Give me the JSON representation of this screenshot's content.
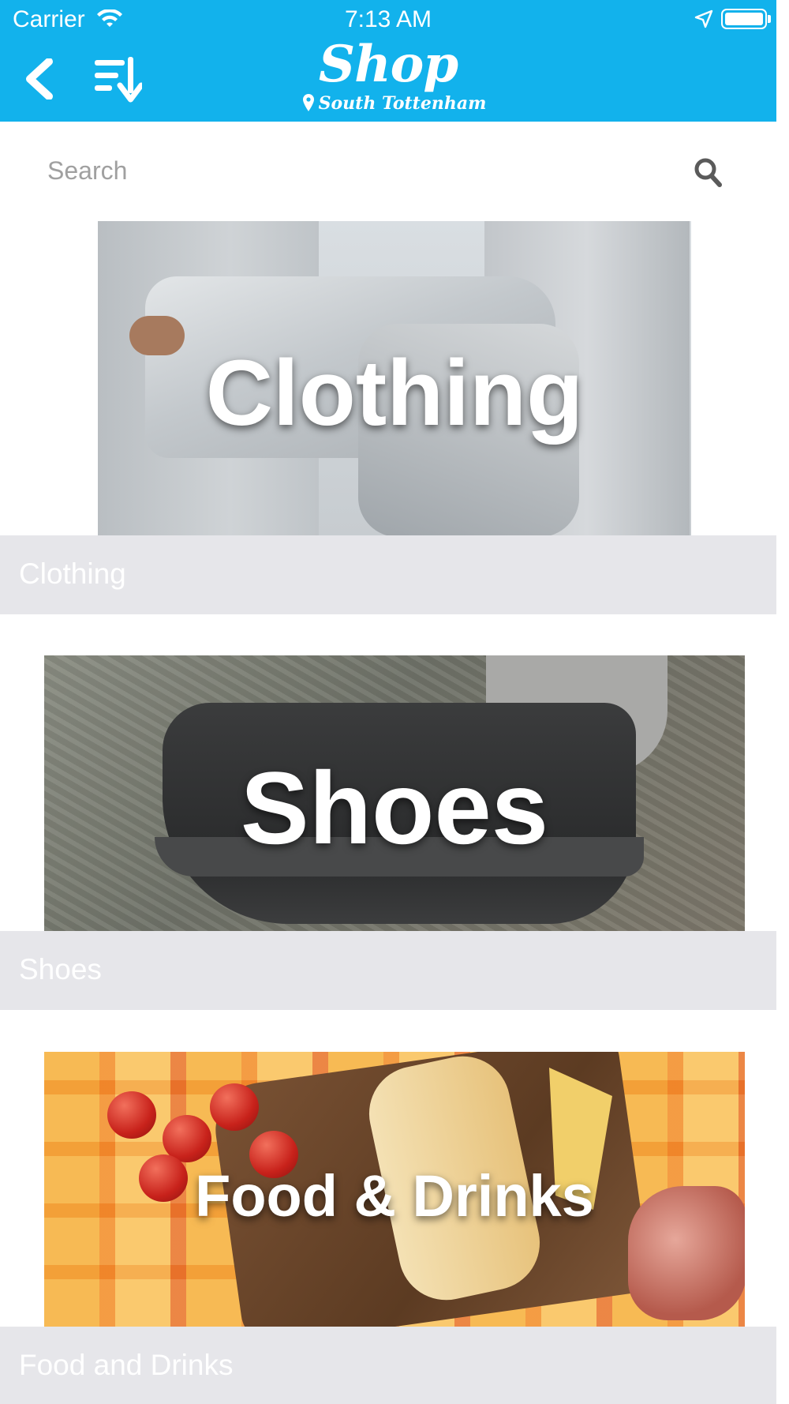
{
  "status_bar": {
    "carrier": "Carrier",
    "time": "7:13 AM"
  },
  "nav": {
    "title": "Shop",
    "location": "South Tottenham",
    "colors": {
      "bar": "#12b2ec",
      "text": "#ffffff"
    }
  },
  "search": {
    "placeholder": "Search",
    "value": ""
  },
  "categories": [
    {
      "banner_text": "Clothing",
      "label": "Clothing"
    },
    {
      "banner_text": "Shoes",
      "label": "Shoes"
    },
    {
      "banner_text": "Food & Drinks",
      "label": "Food and Drinks"
    }
  ],
  "icons": {
    "back": "chevron-left-icon",
    "sort": "sort-descending-icon",
    "search": "search-icon",
    "location_pin": "map-pin-icon"
  }
}
